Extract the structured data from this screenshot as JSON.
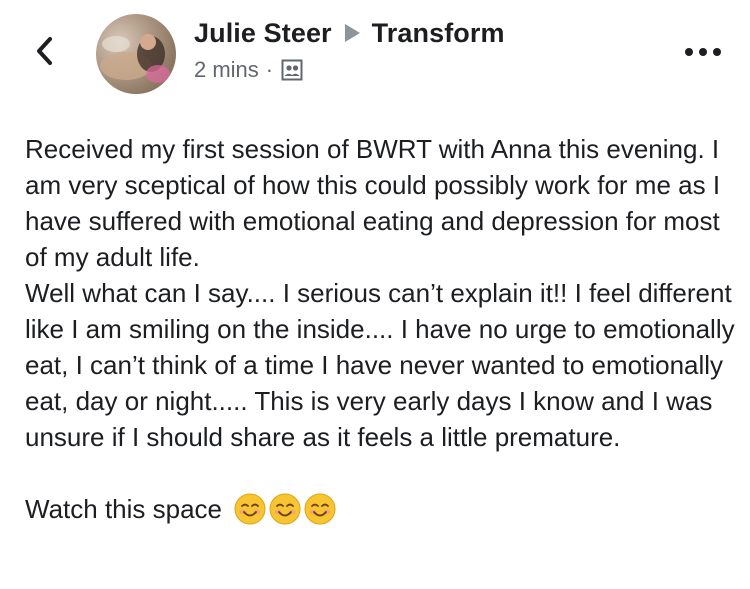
{
  "header": {
    "author_name": "Julie Steer",
    "group_name": "Transform",
    "timestamp": "2 mins",
    "separator": "·",
    "privacy_icon": "group-members-icon",
    "back_icon": "chevron-left-icon",
    "more_icon": "more-horizontal-icon"
  },
  "post": {
    "body": "Received my first session of BWRT with Anna this evening. I am very sceptical of how this could possibly work for me as I have suffered with emotional eating and depression for most of my adult life.\nWell what can I say.... I serious can’t explain it!! I feel different like I am smiling on the inside.... I have no urge to emotionally eat, I can’t think of a time I have never wanted to emotionally eat, day or night..... This is very early days I know and I was unsure if I should share as it feels a little premature.",
    "closing": "Watch this space",
    "emojis": [
      "smiling-face-icon",
      "smiling-face-icon",
      "smiling-face-icon"
    ]
  },
  "colors": {
    "text": "#1c1e21",
    "meta": "#616770",
    "arrow": "#8d949e",
    "emoji": "#f7c531"
  }
}
